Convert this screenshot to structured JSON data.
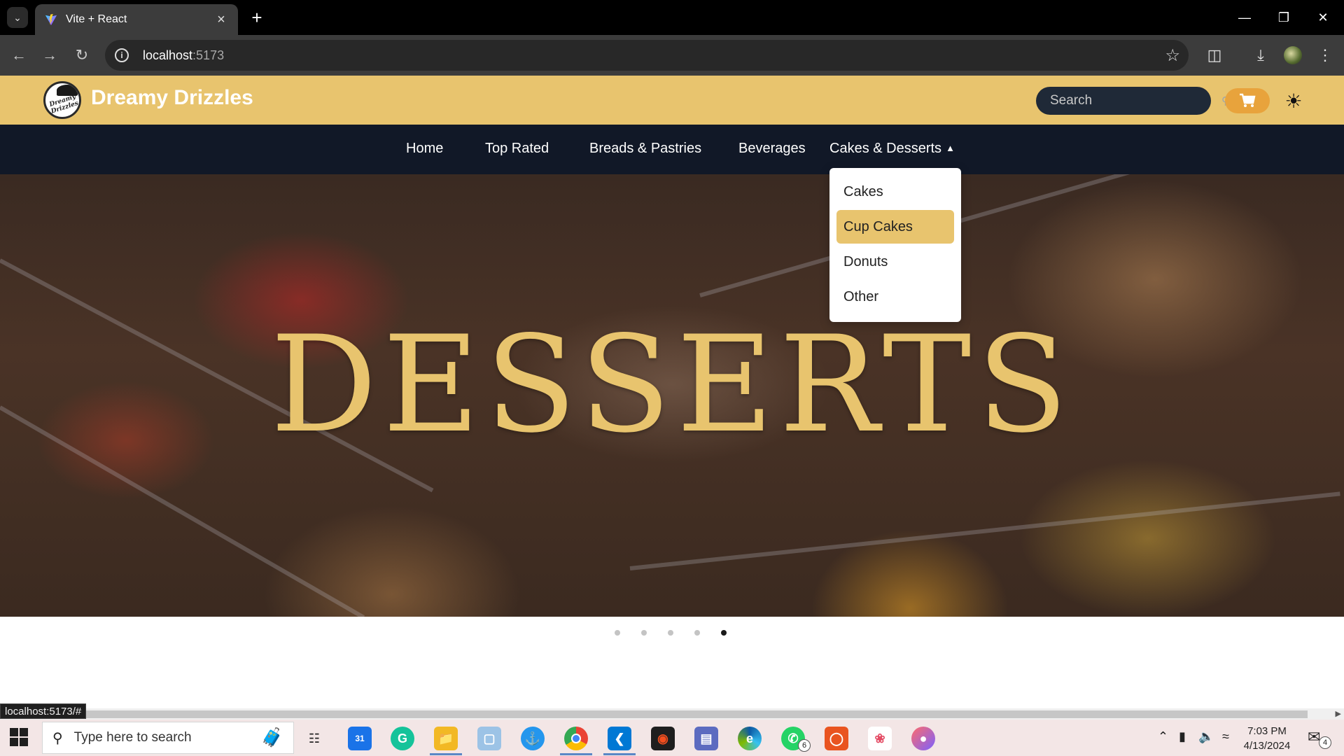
{
  "browser": {
    "tab_title": "Vite + React",
    "url_host": "localhost",
    "url_port": ":5173",
    "status_url": "localhost:5173/#"
  },
  "site": {
    "brand": "Dreamy Drizzles",
    "logo_text": "Dreamy Drizzles",
    "search_placeholder": "Search",
    "accent_color": "#e8c46e",
    "nav_color": "#111827"
  },
  "nav": {
    "items": [
      {
        "label": "Home"
      },
      {
        "label": "Top Rated"
      },
      {
        "label": "Breads & Pastries"
      },
      {
        "label": "Beverages"
      },
      {
        "label": "Cakes & Desserts"
      }
    ]
  },
  "dropdown": {
    "items": [
      {
        "label": "Cakes"
      },
      {
        "label": "Cup Cakes"
      },
      {
        "label": "Donuts"
      },
      {
        "label": "Other"
      }
    ],
    "highlighted_index": 1
  },
  "hero": {
    "title": "DESSERTS",
    "slide_count": 5,
    "active_slide": 5
  },
  "taskbar": {
    "search_placeholder": "Type here to search",
    "whatsapp_badge": "6",
    "time": "7:03 PM",
    "date": "4/13/2024",
    "notification_count": "4"
  }
}
